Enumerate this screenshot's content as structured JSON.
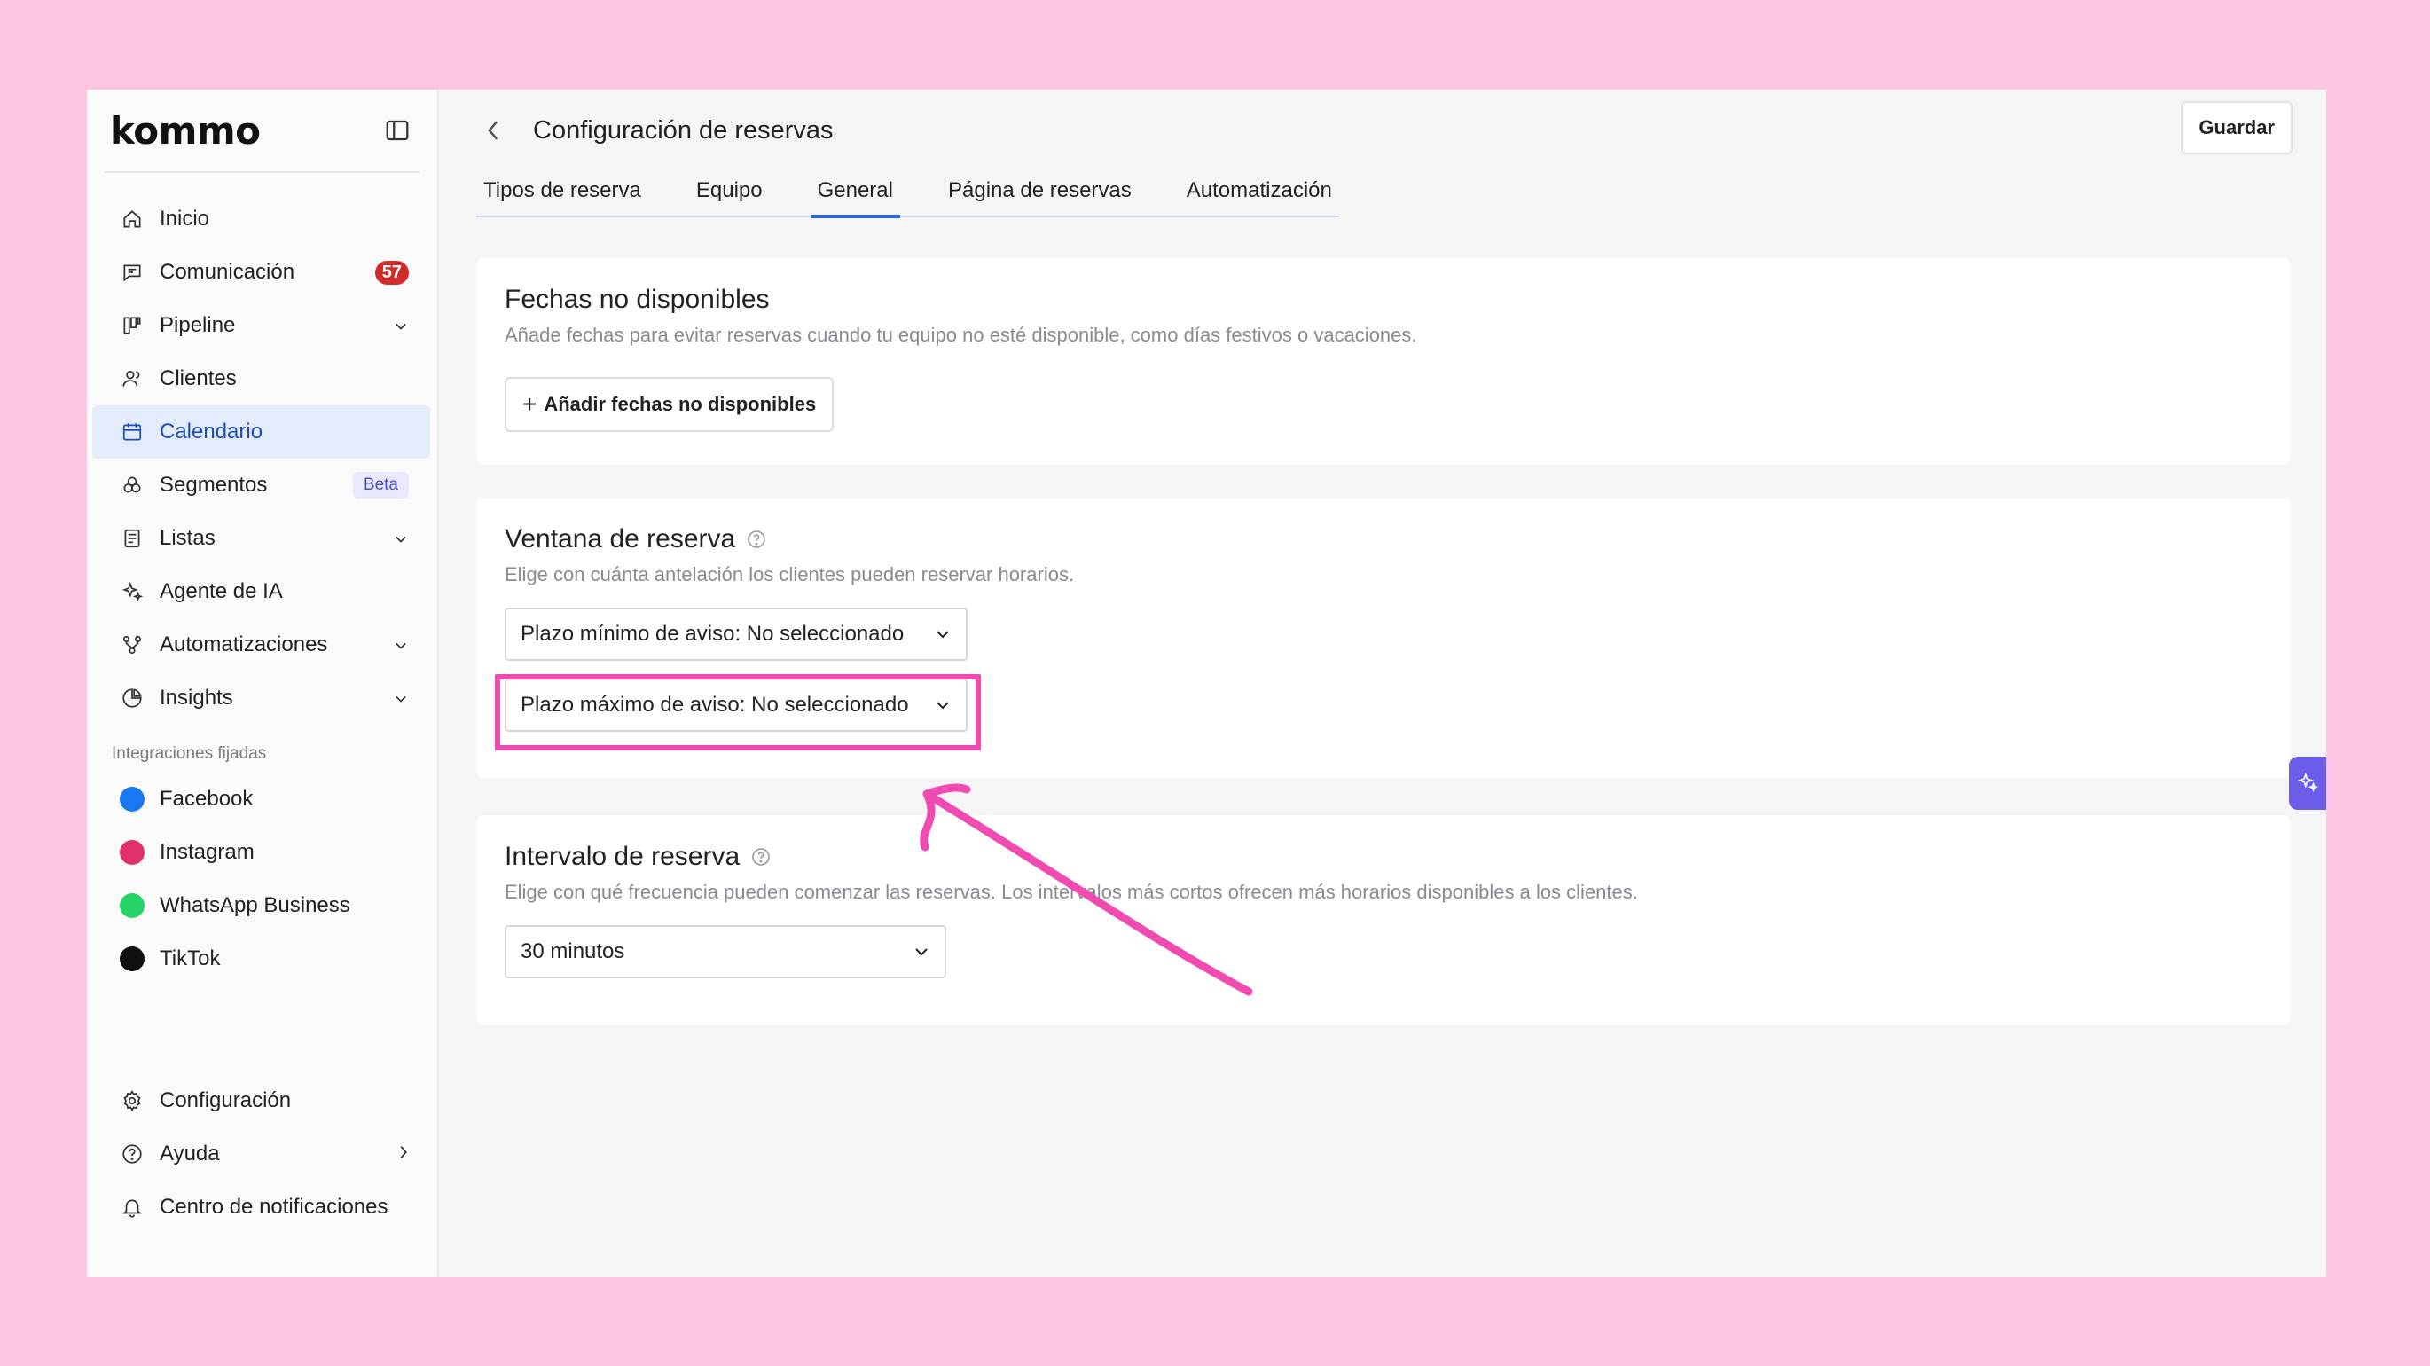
{
  "app": {
    "logo": "kommo"
  },
  "sidebar": {
    "items": [
      {
        "label": "Inicio",
        "icon": "home-icon"
      },
      {
        "label": "Comunicación",
        "icon": "chat-icon",
        "badge": "57"
      },
      {
        "label": "Pipeline",
        "icon": "pipeline-icon",
        "chevron": true
      },
      {
        "label": "Clientes",
        "icon": "users-icon"
      },
      {
        "label": "Calendario",
        "icon": "calendar-icon",
        "active": true
      },
      {
        "label": "Segmentos",
        "icon": "segments-icon",
        "tag": "Beta"
      },
      {
        "label": "Listas",
        "icon": "list-icon",
        "chevron": true
      },
      {
        "label": "Agente de IA",
        "icon": "sparkle-icon"
      },
      {
        "label": "Automatizaciones",
        "icon": "automation-icon",
        "chevron": true
      },
      {
        "label": "Insights",
        "icon": "pie-chart-icon",
        "chevron": true
      }
    ],
    "integrations_label": "Integraciones fijadas",
    "integrations": [
      {
        "label": "Facebook",
        "icon": "facebook-icon",
        "color": "#1877f2"
      },
      {
        "label": "Instagram",
        "icon": "instagram-icon",
        "color": "#e1306c"
      },
      {
        "label": "WhatsApp Business",
        "icon": "whatsapp-icon",
        "color": "#25d366"
      },
      {
        "label": "TikTok",
        "icon": "tiktok-icon",
        "color": "#111111"
      }
    ],
    "bottom": [
      {
        "label": "Configuración",
        "icon": "gear-icon"
      },
      {
        "label": "Ayuda",
        "icon": "help-icon"
      },
      {
        "label": "Centro de notificaciones",
        "icon": "bell-icon"
      }
    ]
  },
  "header": {
    "title": "Configuración de reservas",
    "save_label": "Guardar"
  },
  "tabs": [
    {
      "label": "Tipos de reserva"
    },
    {
      "label": "Equipo"
    },
    {
      "label": "General",
      "active": true
    },
    {
      "label": "Página de reservas"
    },
    {
      "label": "Automatización"
    }
  ],
  "unavailable": {
    "title": "Fechas no disponibles",
    "description": "Añade fechas para evitar reservas cuando tu equipo no esté disponible, como días festivos o vacaciones.",
    "button": "Añadir fechas no disponibles"
  },
  "window": {
    "title": "Ventana de reserva",
    "description": "Elige con cuánta antelación los clientes pueden reservar horarios.",
    "min_select": "Plazo mínimo de aviso: No seleccionado",
    "max_select": "Plazo máximo de aviso: No seleccionado"
  },
  "interval": {
    "title": "Intervalo de reserva",
    "description": "Elige con qué frecuencia pueden comenzar las reservas. Los intervalos más cortos ofrecen más horarios disponibles a los clientes.",
    "select": "30 minutos"
  },
  "colors": {
    "accent": "#2d64d8",
    "highlight": "#f04bb0",
    "background": "#fcc5e1"
  }
}
